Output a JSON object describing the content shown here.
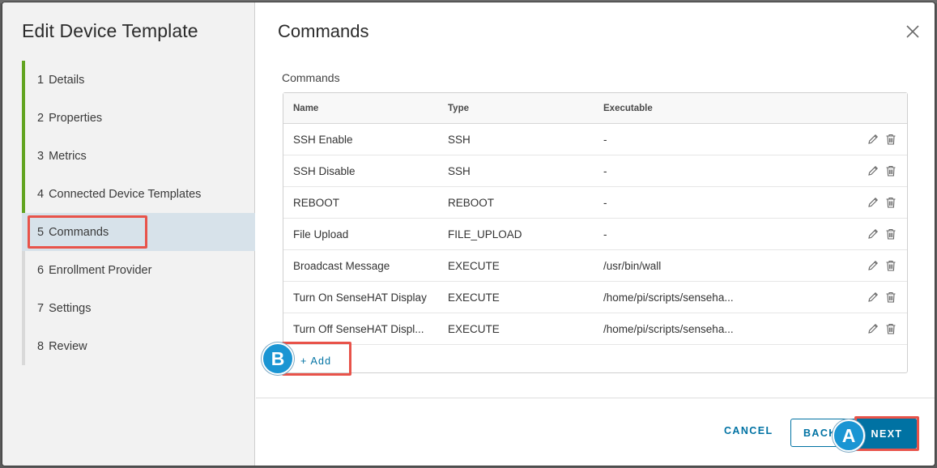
{
  "wizard": {
    "title": "Edit Device Template",
    "steps": [
      {
        "num": "1",
        "label": "Details"
      },
      {
        "num": "2",
        "label": "Properties"
      },
      {
        "num": "3",
        "label": "Metrics"
      },
      {
        "num": "4",
        "label": "Connected Device Templates"
      },
      {
        "num": "5",
        "label": "Commands"
      },
      {
        "num": "6",
        "label": "Enrollment Provider"
      },
      {
        "num": "7",
        "label": "Settings"
      },
      {
        "num": "8",
        "label": "Review"
      }
    ]
  },
  "content": {
    "title": "Commands",
    "section_label": "Commands",
    "columns": {
      "name": "Name",
      "type": "Type",
      "executable": "Executable"
    },
    "rows": [
      {
        "name": "SSH Enable",
        "type": "SSH",
        "executable": "-"
      },
      {
        "name": "SSH Disable",
        "type": "SSH",
        "executable": "-"
      },
      {
        "name": "REBOOT",
        "type": "REBOOT",
        "executable": "-"
      },
      {
        "name": "File Upload",
        "type": "FILE_UPLOAD",
        "executable": "-"
      },
      {
        "name": "Broadcast Message",
        "type": "EXECUTE",
        "executable": "/usr/bin/wall"
      },
      {
        "name": "Turn On SenseHAT Display",
        "type": "EXECUTE",
        "executable": "/home/pi/scripts/senseha..."
      },
      {
        "name": "Turn Off SenseHAT Displ...",
        "type": "EXECUTE",
        "executable": "/home/pi/scripts/senseha..."
      }
    ],
    "add_label": "+ Add"
  },
  "footer": {
    "cancel_label": "CANCEL",
    "back_label": "BACK",
    "next_label": "NEXT"
  },
  "callouts": {
    "a": "A",
    "b": "B"
  },
  "colors": {
    "accent": "#0072a3",
    "step_done": "#62a420",
    "highlight": "#e8534a",
    "callout": "#1a95d3"
  },
  "icons": {
    "close": "close-icon",
    "edit": "pencil-icon",
    "delete": "trash-icon"
  }
}
